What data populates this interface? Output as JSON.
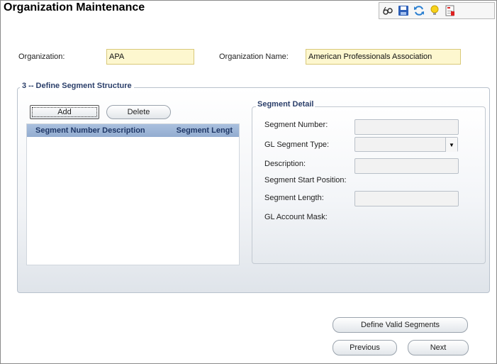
{
  "window": {
    "title": "Organization Maintenance"
  },
  "toolbar": {
    "icons": [
      "glasses-icon",
      "save-icon",
      "refresh-icon",
      "lightbulb-icon",
      "report-icon"
    ]
  },
  "organization": {
    "label": "Organization:",
    "value": "APA",
    "name_label": "Organization Name:",
    "name_value": "American Professionals Association"
  },
  "segment_structure": {
    "legend": "3 -- Define Segment Structure",
    "add_label": "Add",
    "delete_label": "Delete",
    "columns": [
      "Segment Number Description",
      "Segment Lengt"
    ],
    "rows": []
  },
  "segment_detail": {
    "legend": "Segment Detail",
    "segment_number_label": "Segment Number:",
    "segment_number_value": "",
    "gl_segment_type_label": "GL Segment Type:",
    "gl_segment_type_value": "",
    "description_label": "Description:",
    "description_value": "",
    "start_position_label": "Segment Start Position:",
    "segment_length_label": "Segment Length:",
    "segment_length_value": "",
    "gl_account_mask_label": "GL Account Mask:"
  },
  "actions": {
    "define_valid_segments": "Define Valid Segments",
    "previous": "Previous",
    "next": "Next"
  }
}
